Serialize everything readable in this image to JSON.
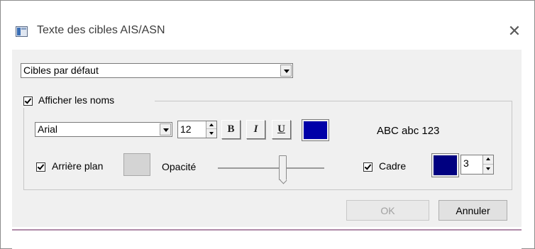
{
  "window": {
    "title": "Texte des cibles AIS/ASN"
  },
  "target_set": {
    "selected": "Cibles par défaut"
  },
  "show_names": {
    "label": "Afficher les noms",
    "checked": true
  },
  "font": {
    "family": "Arial",
    "size": "12",
    "bold_label": "B",
    "italic_label": "I",
    "underline_label": "U",
    "color": "#0000a8"
  },
  "preview": {
    "text": "ABC abc 123"
  },
  "background": {
    "label": "Arrière plan",
    "checked": true,
    "color": "#d4d4d4"
  },
  "opacity": {
    "label": "Opacité",
    "value_fraction": 0.61
  },
  "frame": {
    "label": "Cadre",
    "checked": true,
    "color": "#000080",
    "width": "3"
  },
  "buttons": {
    "ok": "OK",
    "cancel": "Annuler"
  }
}
